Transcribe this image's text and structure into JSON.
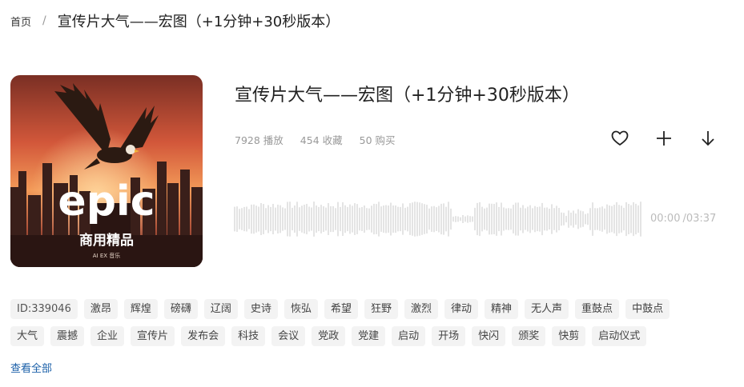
{
  "breadcrumb": {
    "home": "首页",
    "separator": "/",
    "current": "宣传片大气——宏图（+1分钟+30秒版本）"
  },
  "cover": {
    "logo_text": "epic",
    "subtitle": "商用精品",
    "small_text": "AI EX 音乐",
    "colors": {
      "sky_top": "#8a3b2a",
      "sky_mid": "#e0693a",
      "sky_glow": "#f7a55b",
      "city": "#2a1a18"
    }
  },
  "track": {
    "title": "宣传片大气——宏图（+1分钟+30秒版本）",
    "plays": "7928 播放",
    "favorites": "454 收藏",
    "purchases": "50 购买"
  },
  "actions": {
    "favorite_icon": "heart-icon",
    "add_icon": "plus-icon",
    "download_icon": "download-arrow-icon"
  },
  "player": {
    "current_time": "00:00",
    "duration": "/03:37",
    "progress": 0
  },
  "tags": {
    "row1": [
      "ID:339046",
      "激昂",
      "辉煌",
      "磅礴",
      "辽阔",
      "史诗",
      "恢弘",
      "希望",
      "狂野",
      "激烈",
      "律动",
      "精神",
      "无人声",
      "重鼓点",
      "中鼓点"
    ],
    "row2": [
      "大气",
      "震撼",
      "企业",
      "宣传片",
      "发布会",
      "科技",
      "会议",
      "党政",
      "党建",
      "启动",
      "开场",
      "快闪",
      "颁奖",
      "快剪",
      "启动仪式"
    ]
  },
  "view_all": "查看全部"
}
